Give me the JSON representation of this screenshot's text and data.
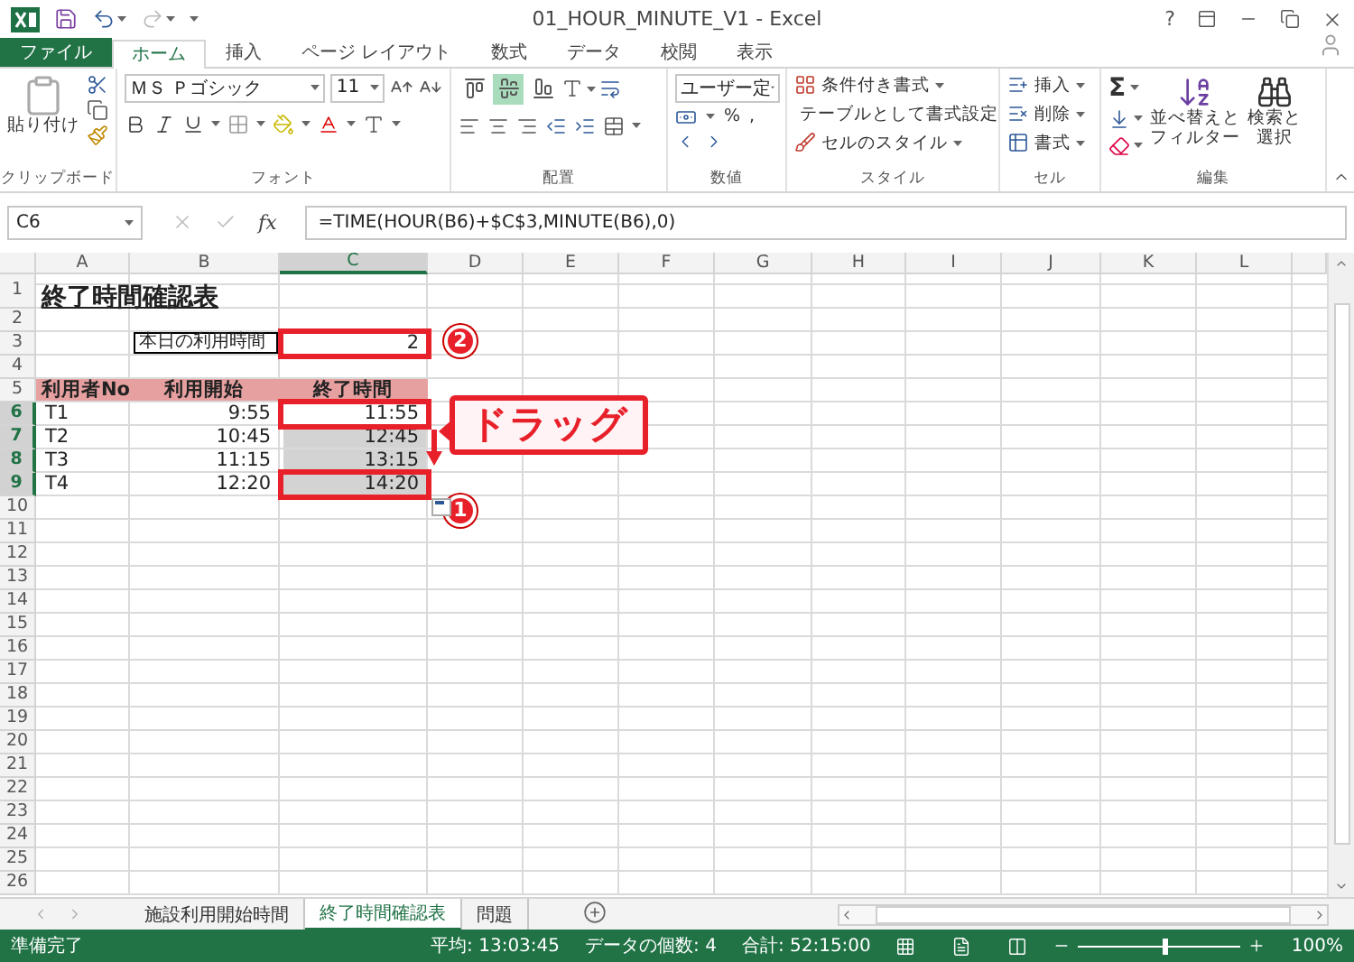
{
  "window": {
    "title": "01_HOUR_MINUTE_V1 - Excel",
    "help": "?"
  },
  "tabs": [
    {
      "label": "ファイル",
      "kind": "file",
      "selected": false
    },
    {
      "label": "ホーム",
      "kind": "tab",
      "selected": true
    },
    {
      "label": "挿入",
      "kind": "tab",
      "selected": false
    },
    {
      "label": "ページ レイアウト",
      "kind": "tab",
      "selected": false
    },
    {
      "label": "数式",
      "kind": "tab",
      "selected": false
    },
    {
      "label": "データ",
      "kind": "tab",
      "selected": false
    },
    {
      "label": "校閲",
      "kind": "tab",
      "selected": false
    },
    {
      "label": "表示",
      "kind": "tab",
      "selected": false
    }
  ],
  "ribbon": {
    "clipboard": {
      "paste": "貼り付け",
      "caption": "クリップボード"
    },
    "font": {
      "name": "ＭＳ Ｐゴシック",
      "size": "11",
      "caption": "フォント"
    },
    "alignment": {
      "vertical_buttons": [
        {
          "selected": false
        },
        {
          "selected": true
        },
        {
          "selected": false
        }
      ],
      "caption": "配置"
    },
    "number": {
      "format": "ユーザー定",
      "percent": "%",
      "comma": ",",
      "caption": "数値"
    },
    "styles": {
      "items": [
        "条件付き書式",
        "テーブルとして書式設定",
        "セルのスタイル"
      ],
      "caption": "スタイル"
    },
    "cells": {
      "items": [
        "挿入",
        "削除",
        "書式"
      ],
      "caption": "セル"
    },
    "editing": {
      "sum": "Σ",
      "sort": [
        "並べ替えと",
        "フィルター"
      ],
      "find": [
        "検索と",
        "選択"
      ],
      "caption": "編集"
    }
  },
  "formula_bar": {
    "name_box": "C6",
    "function_label": "fx",
    "formula": "=TIME(HOUR(B6)+$C$3,MINUTE(B6),0)"
  },
  "sheet": {
    "columns": [
      {
        "label": "A",
        "selected": false
      },
      {
        "label": "B",
        "selected": false
      },
      {
        "label": "C",
        "selected": true
      },
      {
        "label": "D",
        "selected": false
      },
      {
        "label": "E",
        "selected": false
      },
      {
        "label": "F",
        "selected": false
      },
      {
        "label": "G",
        "selected": false
      },
      {
        "label": "H",
        "selected": false
      },
      {
        "label": "I",
        "selected": false
      },
      {
        "label": "J",
        "selected": false
      },
      {
        "label": "K",
        "selected": false
      },
      {
        "label": "L",
        "selected": false
      }
    ],
    "rows": [
      {
        "number": "1",
        "selected": false,
        "cells": [
          {
            "text": "終了時間確認表",
            "kind": "title",
            "selected": false,
            "framed": false
          }
        ]
      },
      {
        "number": "2",
        "selected": false
      },
      {
        "number": "3",
        "selected": false,
        "cells": [
          {
            "kind": "empty"
          },
          {
            "text": "本日の利用時間",
            "kind": "label",
            "selected": false,
            "framed": false
          },
          {
            "text": "2",
            "kind": "number",
            "selected": false,
            "framed": true
          }
        ]
      },
      {
        "number": "4",
        "selected": false
      },
      {
        "number": "5",
        "selected": false,
        "cells": [
          {
            "text": "利用者No",
            "kind": "header",
            "selected": false,
            "framed": false
          },
          {
            "text": "利用開始",
            "kind": "header-center",
            "selected": false,
            "framed": false
          },
          {
            "text": "終了時間",
            "kind": "header-center",
            "selected": false,
            "framed": false
          }
        ]
      },
      {
        "number": "6",
        "selected": true,
        "cells": [
          {
            "text": "T1",
            "kind": "text",
            "selected": false,
            "framed": false
          },
          {
            "text": "9:55",
            "kind": "number",
            "selected": false,
            "framed": false
          },
          {
            "text": "11:55",
            "kind": "number",
            "selected": false,
            "framed": true
          }
        ]
      },
      {
        "number": "7",
        "selected": true,
        "cells": [
          {
            "text": "T2",
            "kind": "text",
            "selected": false,
            "framed": false
          },
          {
            "text": "10:45",
            "kind": "number",
            "selected": false,
            "framed": false
          },
          {
            "text": "12:45",
            "kind": "number",
            "selected": true,
            "framed": false
          }
        ]
      },
      {
        "number": "8",
        "selected": true,
        "cells": [
          {
            "text": "T3",
            "kind": "text",
            "selected": false,
            "framed": false
          },
          {
            "text": "11:15",
            "kind": "number",
            "selected": false,
            "framed": false
          },
          {
            "text": "13:15",
            "kind": "number",
            "selected": true,
            "framed": false
          }
        ]
      },
      {
        "number": "9",
        "selected": true,
        "cells": [
          {
            "text": "T4",
            "kind": "text",
            "selected": false,
            "framed": false
          },
          {
            "text": "12:20",
            "kind": "number",
            "selected": false,
            "framed": false
          },
          {
            "text": "14:20",
            "kind": "number",
            "selected": true,
            "framed": true
          }
        ]
      },
      {
        "number": "10",
        "selected": false
      },
      {
        "number": "11",
        "selected": false
      },
      {
        "number": "12",
        "selected": false
      },
      {
        "number": "13",
        "selected": false
      },
      {
        "number": "14",
        "selected": false
      },
      {
        "number": "15",
        "selected": false
      },
      {
        "number": "16",
        "selected": false
      },
      {
        "number": "17",
        "selected": false
      },
      {
        "number": "18",
        "selected": false
      },
      {
        "number": "19",
        "selected": false
      },
      {
        "number": "20",
        "selected": false
      },
      {
        "number": "21",
        "selected": false
      },
      {
        "number": "22",
        "selected": false
      },
      {
        "number": "23",
        "selected": false
      },
      {
        "number": "24",
        "selected": false
      },
      {
        "number": "25",
        "selected": false
      },
      {
        "number": "26",
        "selected": false
      }
    ],
    "annotations": {
      "callout": "ドラッグ",
      "markers": [
        "2",
        "1"
      ]
    }
  },
  "sheet_tabs": [
    {
      "label": "施設利用開始時間",
      "selected": false
    },
    {
      "label": "終了時間確認表",
      "selected": true
    },
    {
      "label": "問題",
      "selected": false
    }
  ],
  "status_bar": {
    "ready": "準備完了",
    "average": "平均: 13:03:45",
    "count": "データの個数: 4",
    "sum": "合計: 52:15:00",
    "zoom_slider": {
      "level": 0.52
    },
    "zoom": "100%"
  }
}
